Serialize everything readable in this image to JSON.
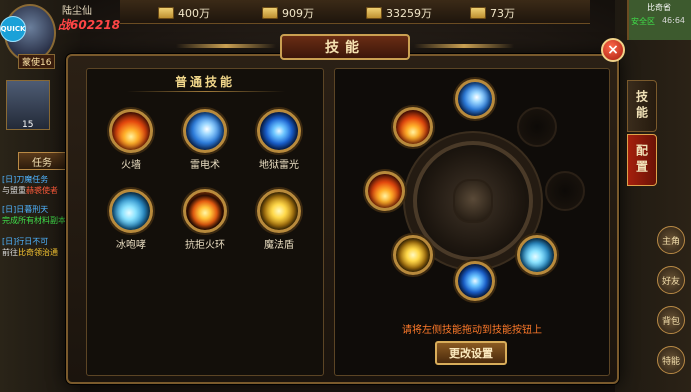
{
  "hud": {
    "resources": [
      {
        "icon": "gold-ingot-icon",
        "value": "400万"
      },
      {
        "icon": "silver-ingot-icon",
        "value": "909万"
      },
      {
        "icon": "yuanbao-icon",
        "value": "33259万"
      },
      {
        "icon": "bound-yuanbao-icon",
        "value": "73万"
      }
    ],
    "player": {
      "name": "陆尘仙",
      "power": "战602218",
      "level": "蒙使16"
    },
    "quick_label": "QUICK",
    "task_tab": "任务",
    "hero_level": "15",
    "quests": [
      {
        "title": "[日]刀魔任务",
        "desc": "与盟重",
        "link": "赫裘使者"
      },
      {
        "title": "[日]日暮刑天",
        "desc": "完成所有材料副本",
        "link": ""
      },
      {
        "title": "[日]行日不可",
        "desc": "前往",
        "link": "比奇领治通"
      }
    ],
    "minimap": {
      "location": "比奇省",
      "safe": "安全区",
      "time": "46:64"
    },
    "hud_buttons": [
      "主角",
      "好友",
      "背包",
      "特能"
    ]
  },
  "dialog": {
    "title": "技能",
    "list_title": "普通技能",
    "skills": [
      {
        "id": "fire-wall",
        "label": "火墙",
        "orb": "fire"
      },
      {
        "id": "thunder",
        "label": "雷电术",
        "orb": "thunder"
      },
      {
        "id": "hell-thunder",
        "label": "地狱雷光",
        "orb": "hell"
      },
      {
        "id": "ice-roar",
        "label": "冰咆哮",
        "orb": "ice"
      },
      {
        "id": "repel-ring",
        "label": "抗拒火环",
        "orb": "ring"
      },
      {
        "id": "magic-shield",
        "label": "魔法盾",
        "orb": "shield"
      }
    ],
    "hint": "请将左侧技能拖动到技能按钮上",
    "change_button": "更改设置",
    "tabs": {
      "skill": "技能",
      "config": "配置"
    },
    "close_label": "×"
  }
}
